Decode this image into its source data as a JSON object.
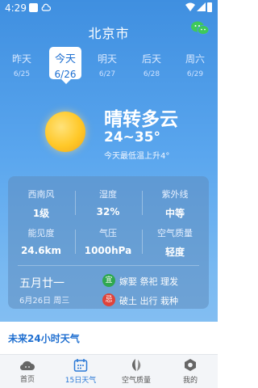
{
  "status": {
    "time": "4:29"
  },
  "header": {
    "city": "北京市"
  },
  "days": [
    {
      "name": "昨天",
      "date": "6/25"
    },
    {
      "name": "今天",
      "date": "6/26"
    },
    {
      "name": "明天",
      "date": "6/27"
    },
    {
      "name": "后天",
      "date": "6/28"
    },
    {
      "name": "周六",
      "date": "6/29"
    }
  ],
  "weather": {
    "condition": "晴转多云",
    "temp_range": "24~35°",
    "note": "今天最低温上升4°"
  },
  "details": [
    {
      "label": "西南风",
      "value": "1级"
    },
    {
      "label": "湿度",
      "value": "32%"
    },
    {
      "label": "紫外线",
      "value": "中等"
    },
    {
      "label": "能见度",
      "value": "24.6km"
    },
    {
      "label": "气压",
      "value": "1000hPa"
    },
    {
      "label": "空气质量",
      "value": "轻度"
    }
  ],
  "almanac": {
    "lunar": "五月廿一",
    "date": "6月26日 周三",
    "yi_tag": "宜",
    "yi": "嫁娶 祭祀 理发",
    "ji_tag": "忌",
    "ji": "破土 出行 栽种"
  },
  "forecast_title": "未来24小时天气",
  "nav": [
    {
      "label": "首页",
      "icon": "cloud-icon"
    },
    {
      "label": "15日天气",
      "icon": "calendar-icon"
    },
    {
      "label": "空气质量",
      "icon": "leaf-icon"
    },
    {
      "label": "我的",
      "icon": "settings-icon"
    }
  ],
  "colors": {
    "accent": "#2a78d6",
    "yi": "#2fa84f",
    "ji": "#e0433a"
  }
}
